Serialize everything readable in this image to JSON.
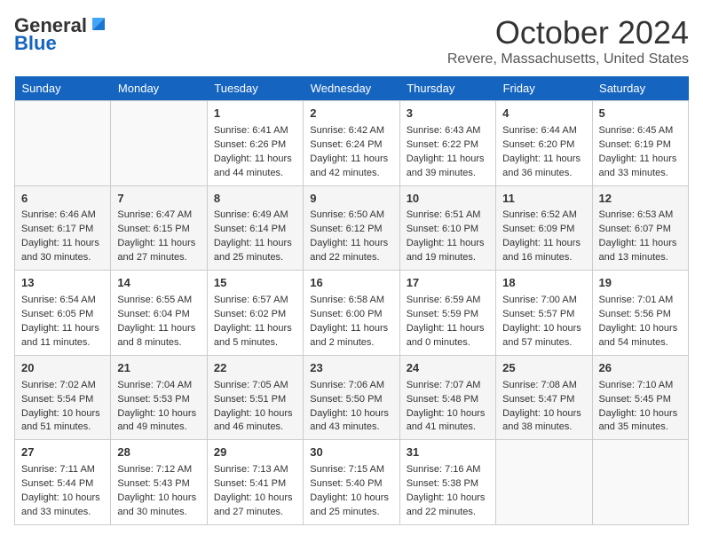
{
  "header": {
    "logo_general": "General",
    "logo_blue": "Blue",
    "month_title": "October 2024",
    "location": "Revere, Massachusetts, United States"
  },
  "days_of_week": [
    "Sunday",
    "Monday",
    "Tuesday",
    "Wednesday",
    "Thursday",
    "Friday",
    "Saturday"
  ],
  "weeks": [
    [
      {
        "day": "",
        "content": ""
      },
      {
        "day": "",
        "content": ""
      },
      {
        "day": "1",
        "content": "Sunrise: 6:41 AM\nSunset: 6:26 PM\nDaylight: 11 hours and 44 minutes."
      },
      {
        "day": "2",
        "content": "Sunrise: 6:42 AM\nSunset: 6:24 PM\nDaylight: 11 hours and 42 minutes."
      },
      {
        "day": "3",
        "content": "Sunrise: 6:43 AM\nSunset: 6:22 PM\nDaylight: 11 hours and 39 minutes."
      },
      {
        "day": "4",
        "content": "Sunrise: 6:44 AM\nSunset: 6:20 PM\nDaylight: 11 hours and 36 minutes."
      },
      {
        "day": "5",
        "content": "Sunrise: 6:45 AM\nSunset: 6:19 PM\nDaylight: 11 hours and 33 minutes."
      }
    ],
    [
      {
        "day": "6",
        "content": "Sunrise: 6:46 AM\nSunset: 6:17 PM\nDaylight: 11 hours and 30 minutes."
      },
      {
        "day": "7",
        "content": "Sunrise: 6:47 AM\nSunset: 6:15 PM\nDaylight: 11 hours and 27 minutes."
      },
      {
        "day": "8",
        "content": "Sunrise: 6:49 AM\nSunset: 6:14 PM\nDaylight: 11 hours and 25 minutes."
      },
      {
        "day": "9",
        "content": "Sunrise: 6:50 AM\nSunset: 6:12 PM\nDaylight: 11 hours and 22 minutes."
      },
      {
        "day": "10",
        "content": "Sunrise: 6:51 AM\nSunset: 6:10 PM\nDaylight: 11 hours and 19 minutes."
      },
      {
        "day": "11",
        "content": "Sunrise: 6:52 AM\nSunset: 6:09 PM\nDaylight: 11 hours and 16 minutes."
      },
      {
        "day": "12",
        "content": "Sunrise: 6:53 AM\nSunset: 6:07 PM\nDaylight: 11 hours and 13 minutes."
      }
    ],
    [
      {
        "day": "13",
        "content": "Sunrise: 6:54 AM\nSunset: 6:05 PM\nDaylight: 11 hours and 11 minutes."
      },
      {
        "day": "14",
        "content": "Sunrise: 6:55 AM\nSunset: 6:04 PM\nDaylight: 11 hours and 8 minutes."
      },
      {
        "day": "15",
        "content": "Sunrise: 6:57 AM\nSunset: 6:02 PM\nDaylight: 11 hours and 5 minutes."
      },
      {
        "day": "16",
        "content": "Sunrise: 6:58 AM\nSunset: 6:00 PM\nDaylight: 11 hours and 2 minutes."
      },
      {
        "day": "17",
        "content": "Sunrise: 6:59 AM\nSunset: 5:59 PM\nDaylight: 11 hours and 0 minutes."
      },
      {
        "day": "18",
        "content": "Sunrise: 7:00 AM\nSunset: 5:57 PM\nDaylight: 10 hours and 57 minutes."
      },
      {
        "day": "19",
        "content": "Sunrise: 7:01 AM\nSunset: 5:56 PM\nDaylight: 10 hours and 54 minutes."
      }
    ],
    [
      {
        "day": "20",
        "content": "Sunrise: 7:02 AM\nSunset: 5:54 PM\nDaylight: 10 hours and 51 minutes."
      },
      {
        "day": "21",
        "content": "Sunrise: 7:04 AM\nSunset: 5:53 PM\nDaylight: 10 hours and 49 minutes."
      },
      {
        "day": "22",
        "content": "Sunrise: 7:05 AM\nSunset: 5:51 PM\nDaylight: 10 hours and 46 minutes."
      },
      {
        "day": "23",
        "content": "Sunrise: 7:06 AM\nSunset: 5:50 PM\nDaylight: 10 hours and 43 minutes."
      },
      {
        "day": "24",
        "content": "Sunrise: 7:07 AM\nSunset: 5:48 PM\nDaylight: 10 hours and 41 minutes."
      },
      {
        "day": "25",
        "content": "Sunrise: 7:08 AM\nSunset: 5:47 PM\nDaylight: 10 hours and 38 minutes."
      },
      {
        "day": "26",
        "content": "Sunrise: 7:10 AM\nSunset: 5:45 PM\nDaylight: 10 hours and 35 minutes."
      }
    ],
    [
      {
        "day": "27",
        "content": "Sunrise: 7:11 AM\nSunset: 5:44 PM\nDaylight: 10 hours and 33 minutes."
      },
      {
        "day": "28",
        "content": "Sunrise: 7:12 AM\nSunset: 5:43 PM\nDaylight: 10 hours and 30 minutes."
      },
      {
        "day": "29",
        "content": "Sunrise: 7:13 AM\nSunset: 5:41 PM\nDaylight: 10 hours and 27 minutes."
      },
      {
        "day": "30",
        "content": "Sunrise: 7:15 AM\nSunset: 5:40 PM\nDaylight: 10 hours and 25 minutes."
      },
      {
        "day": "31",
        "content": "Sunrise: 7:16 AM\nSunset: 5:38 PM\nDaylight: 10 hours and 22 minutes."
      },
      {
        "day": "",
        "content": ""
      },
      {
        "day": "",
        "content": ""
      }
    ]
  ]
}
